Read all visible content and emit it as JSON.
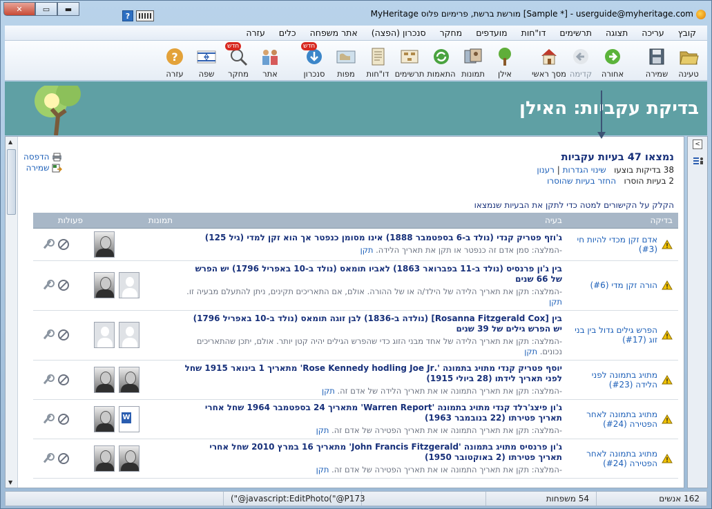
{
  "window": {
    "title": "MyHeritage מורשת ברשת, פרימיום פלוס [Sample *] - userguide@myheritage.com",
    "help_label": "?",
    "minimize_label": "▬",
    "maximize_label": "▭",
    "close_label": "✕"
  },
  "menu": [
    "קובץ",
    "עריכה",
    "תצוגה",
    "תרשימים",
    "דו\"חות",
    "מועדפים",
    "מחקר",
    "סנכרון (הפצה)",
    "אתר משפחה",
    "כלים",
    "עזרה"
  ],
  "toolbar": {
    "new_badge": "חדש",
    "items": [
      {
        "label": "טעינה",
        "icon": "folder-open-icon"
      },
      {
        "label": "שמירה",
        "icon": "save-icon"
      },
      {
        "label": "אחורה",
        "icon": "back-arrow-icon"
      },
      {
        "label": "קדימה",
        "icon": "forward-arrow-icon"
      },
      {
        "label": "מסך ראשי",
        "icon": "home-icon"
      },
      {
        "label": "אילן",
        "icon": "tree-icon"
      },
      {
        "label": "תמונות",
        "icon": "photos-icon"
      },
      {
        "label": "התאמות",
        "icon": "matches-icon"
      },
      {
        "label": "תרשימים",
        "icon": "charts-icon"
      },
      {
        "label": "דו\"חות",
        "icon": "reports-icon"
      },
      {
        "label": "מפות",
        "icon": "maps-icon"
      },
      {
        "label": "סנכרון",
        "icon": "sync-icon"
      },
      {
        "label": "אתר",
        "icon": "website-icon"
      },
      {
        "label": "מחקר",
        "icon": "research-icon"
      },
      {
        "label": "שפה",
        "icon": "language-flag-icon"
      },
      {
        "label": "עזרה",
        "icon": "help-icon"
      }
    ]
  },
  "banner": {
    "title": "בדיקת עקביות: האילן"
  },
  "side_actions": {
    "print_label": "הדפסה",
    "save_label": "שמירה"
  },
  "summary": {
    "heading": "נמצאו 47 בעיות עקביות",
    "line1_text": "38 בדיקות בוצעו",
    "line1_link1": "שינוי הגדרות",
    "line1_sep": "|",
    "line1_link2": "רענון",
    "line2_text": "2 בעיות הוסרו",
    "line2_link": "החזר בעיות שהוסרו",
    "instructions": "הקלק על הקישורים למטה כדי לתקן את הבעיות שנמצאו"
  },
  "table": {
    "headers": {
      "check": "בדיקה",
      "problem": "בעיה",
      "photos": "תמונות",
      "actions": "פעולות"
    },
    "rows": [
      {
        "check": "אדם זקן מכדי להיות חי (#3)",
        "problem_title": "ג'וזף פטריק קנדי (נולד ב-6 בספטמבר 1888) אינו מסומן כנפטר אך הוא זקן למדי (גיל 125)",
        "recommendation": "-המלצה: סמן אדם זה כנפטר או תקן את תאריך הלידה.",
        "fix": "תקן",
        "photos": [
          "face"
        ]
      },
      {
        "check": "הורה זקן מדי (#6)",
        "problem_title": "בין ג'ון פרנסיס (נולד ב-11 בפברואר 1863) לאביו תומאס (נולד ב-10 באפריל 1796) יש הפרש של 66 שנים",
        "recommendation": "-המלצה: תקן את תאריך הלידה של הילד/ה או של ההורה. אולם, אם התאריכים תקינים, ניתן להתעלם מבעיה זו.",
        "fix": "תקן",
        "photos": [
          "face",
          "sil"
        ]
      },
      {
        "check": "הפרש גילים גדול בין בני זוג (#17)",
        "problem_title": "בין [Rosanna Fitzgerald Cox] (נולדה ב-1836) לבן זוגה תומאס (נולד ב-10 באפריל 1796) יש הפרש גילים של 39 שנים",
        "recommendation": "-המלצה: תקן את תאריך הלידה של אחד מבני הזוג כדי שהפרש הגילים יהיה קטן יותר. אולם, יתכן שהתאריכים נכונים.",
        "fix": "תקן",
        "photos": [
          "sil",
          "sil"
        ]
      },
      {
        "check": "מתויג בתמונה לפני הלידה (#23)",
        "problem_title": "יוסף פטריק קנדי מתויג בתמונה '.Rose Kennedy hodling Joe Jr' מתאריך 1 בינואר 1915 שחל לפני תאריך לידתו (28 ביולי 1915)",
        "recommendation": "-המלצה: תקן את תאריך התמונה או את תאריך הלידה של אדם זה.",
        "fix": "תקן",
        "photos": [
          "face",
          "face"
        ]
      },
      {
        "check": "מתויג בתמונה לאחר הפטירה (#24)",
        "problem_title": "ג'ון פיצג'רלד קנדי מתויג בתמונה 'Warren Report' מתאריך 24 בספטמבר 1964 שחל אחרי תאריך פטירתו (22 בנובמבר 1963)",
        "recommendation": "-המלצה: תקן את תאריך התמונה או את תאריך הפטירה של אדם זה.",
        "fix": "תקן",
        "photos": [
          "face",
          "doc"
        ]
      },
      {
        "check": "מתויג בתמונה לאחר הפטירה (#24)",
        "problem_title": "ג'ון פרנסיס מתויג בתמונה 'John Francis Fitzgerald' מתאריך 16 במרץ 2010 שחל אחרי תאריך פטירתו (2 באוקטובר 1950)",
        "recommendation": "-המלצה: תקן את תאריך התמונה או את תאריך הפטירה של אדם זה.",
        "fix": "תקן",
        "photos": [
          "face",
          "face"
        ]
      }
    ]
  },
  "statusbar": {
    "people": "162 אנשים",
    "families": "54 משפחות",
    "url": "(\"@javascript:EditPhoto(\"@P173"
  },
  "colors": {
    "banner": "#5fa0a4",
    "link": "#1c5fb8",
    "heading": "#17307a",
    "table_header": "#a8b7c7"
  }
}
